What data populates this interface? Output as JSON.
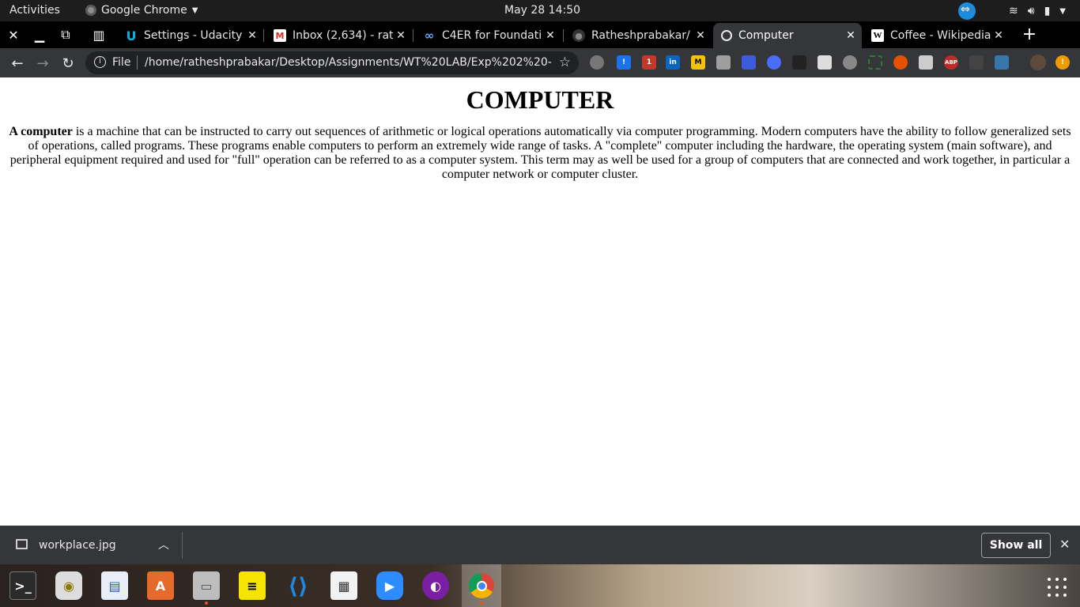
{
  "topbar": {
    "activities": "Activities",
    "app_menu": "Google Chrome",
    "clock": "May 28  14:50"
  },
  "tabs": [
    {
      "title": "Settings - Udacity",
      "favicon": "udacity-icon"
    },
    {
      "title": "Inbox (2,634) - rath",
      "favicon": "gmail-icon"
    },
    {
      "title": "C4ER for Foundati",
      "favicon": "infinity-icon"
    },
    {
      "title": "Ratheshprabakar/",
      "favicon": "github-icon"
    },
    {
      "title": "Computer",
      "favicon": "globe-icon",
      "active": true
    },
    {
      "title": "Coffee - Wikipedia",
      "favicon": "wikipedia-icon"
    }
  ],
  "omnibox": {
    "scheme_label": "File",
    "url": "/home/ratheshprabakar/Desktop/Assignments/WT%20LAB/Exp%202%20-%20..."
  },
  "extensions": {
    "badge_1": "!",
    "badge_2": "1",
    "abp": "ABP",
    "in": "in",
    "m": "M"
  },
  "page": {
    "heading": "COMPUTER",
    "lead_bold": "A computer",
    "body": " is a machine that can be instructed to carry out sequences of arithmetic or logical operations automatically via computer programming. Modern computers have the ability to follow generalized sets of operations, called programs. These programs enable computers to perform an extremely wide range of tasks. A \"complete\" computer including the hardware, the operating system (main software), and peripheral equipment required and used for \"full\" operation can be referred to as a computer system. This term may as well be used for a group of computers that are connected and work together, in particular a computer network or computer cluster."
  },
  "download_bar": {
    "filename": "workplace.jpg",
    "show_all": "Show all"
  },
  "colors": {
    "chrome_dark": "#35363a",
    "tabstrip": "#000000",
    "topbar": "#1d1d1d",
    "page_bg": "#ffffff"
  }
}
